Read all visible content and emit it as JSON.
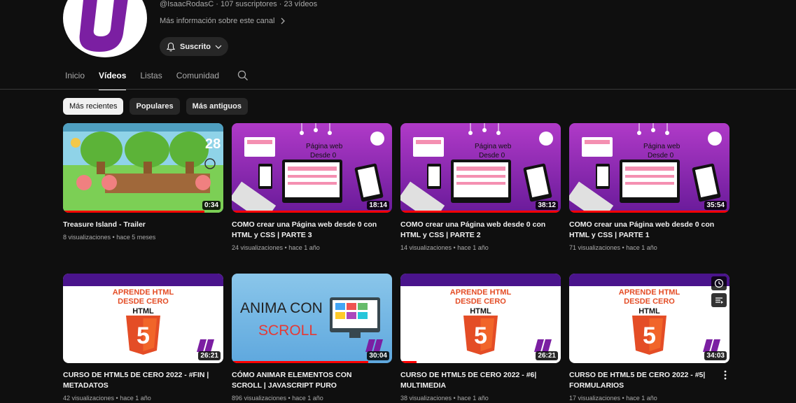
{
  "channel": {
    "meta": "@IsaacRodasC · 107 suscriptores · 23 vídeos",
    "more_info": "Más información sobre este canal",
    "subscribe_label": "Suscrito"
  },
  "tabs": [
    "Inicio",
    "Vídeos",
    "Listas",
    "Comunidad"
  ],
  "chips": [
    "Más recientes",
    "Populares",
    "Más antiguos"
  ],
  "videos": [
    {
      "title": "Treasure Island - Trailer",
      "meta": "8 visualizaciones • hace 5 meses",
      "duration": "0:34",
      "progress": 0.88,
      "thumb": "game",
      "score": "28"
    },
    {
      "title": "COMO crear una Página web desde 0 con HTML y CSS | PARTE 3",
      "meta": "24 visualizaciones • hace 1 año",
      "duration": "18:14",
      "progress": 1.0,
      "thumb": "web",
      "line1": "Página web",
      "line2": "Desde 0"
    },
    {
      "title": "COMO crear una Página web desde 0 con HTML y CSS | PARTE 2",
      "meta": "14 visualizaciones • hace 1 año",
      "duration": "38:12",
      "progress": 1.0,
      "thumb": "web",
      "line1": "Página web",
      "line2": "Desde 0"
    },
    {
      "title": "COMO crear una Página web desde 0 con HTML y CSS | PARTE 1",
      "meta": "71 visualizaciones • hace 1 año",
      "duration": "35:54",
      "progress": 1.0,
      "thumb": "web",
      "line1": "Página web",
      "line2": "Desde 0"
    },
    {
      "title": "CURSO DE HTML5 DE CERO 2022 - #FIN | METADATOS",
      "meta": "42 visualizaciones • hace 1 año",
      "duration": "26:21",
      "progress": 0,
      "thumb": "html",
      "line1": "APRENDE HTML",
      "line2": "DESDE CERO",
      "line3": "HTML"
    },
    {
      "title": "CÓMO ANIMAR ELEMENTOS CON SCROLL | JAVASCRIPT PURO",
      "meta": "896 visualizaciones • hace 1 año",
      "duration": "30:04",
      "progress": 0.85,
      "thumb": "scroll",
      "line1": "ANIMA CON",
      "line2": "SCROLL"
    },
    {
      "title": "CURSO DE HTML5 DE CERO 2022 - #6| MULTIMEDIA",
      "meta": "38 visualizaciones • hace 1 año",
      "duration": "26:21",
      "progress": 0.1,
      "thumb": "html",
      "line1": "APRENDE HTML",
      "line2": "DESDE CERO",
      "line3": "HTML"
    },
    {
      "title": "CURSO DE HTML5 DE CERO 2022 - #5| FORMULARIOS",
      "meta": "17 visualizaciones • hace 1 año",
      "duration": "34:03",
      "progress": 0,
      "thumb": "html",
      "line1": "APRENDE HTML",
      "line2": "DESDE CERO",
      "line3": "HTML",
      "hover": true
    }
  ],
  "colors": {
    "purple": "#7b1fa2",
    "red": "#ff0000",
    "html_orange": "#e44d26",
    "bg": "#0f0f0f"
  }
}
